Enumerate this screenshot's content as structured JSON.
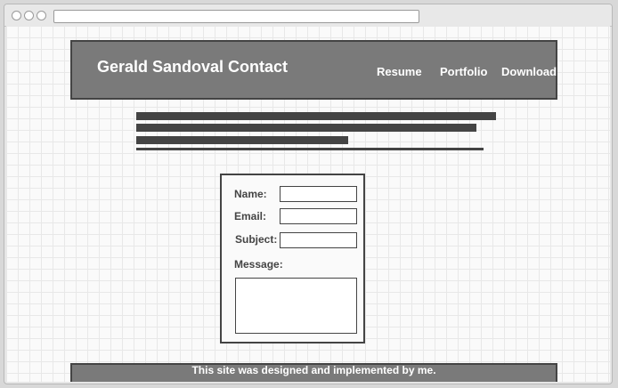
{
  "header": {
    "title": "Gerald Sandoval Contact",
    "nav": [
      {
        "label": "Resume"
      },
      {
        "label": "Portfolio"
      },
      {
        "label": "Download"
      }
    ]
  },
  "form": {
    "name_label": "Name:",
    "email_label": "Email:",
    "subject_label": "Subject:",
    "message_label": "Message:",
    "name_value": "",
    "email_value": "",
    "subject_value": "",
    "message_value": ""
  },
  "footer": {
    "text": "This site was designed and implemented by me."
  }
}
